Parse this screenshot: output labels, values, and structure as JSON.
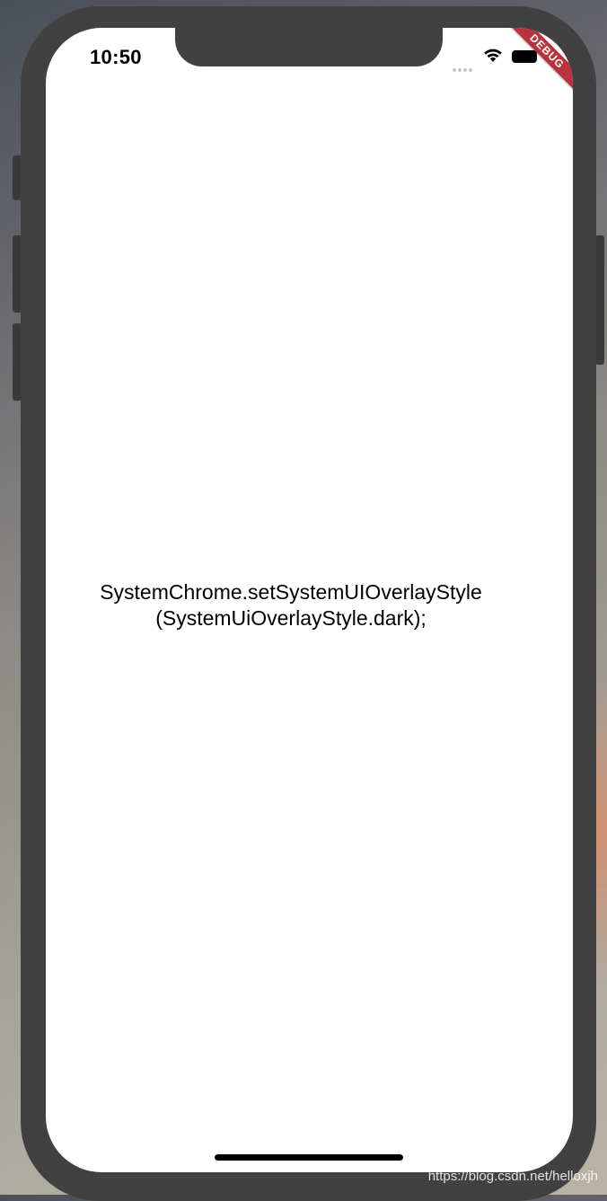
{
  "status_bar": {
    "time": "10:50"
  },
  "debug_banner": {
    "label": "DEBUG"
  },
  "content": {
    "line1": "SystemChrome.setSystemUIOverlayStyle",
    "line2": "(SystemUiOverlayStyle.dark);"
  },
  "watermark": {
    "text": "https://blog.csdn.net/helloxjh"
  },
  "colors": {
    "device_frame": "#414141",
    "debug_banner": "#b8333c",
    "screen_background": "#ffffff"
  },
  "icons": [
    "signal-icon",
    "wifi-icon",
    "battery-icon"
  ]
}
